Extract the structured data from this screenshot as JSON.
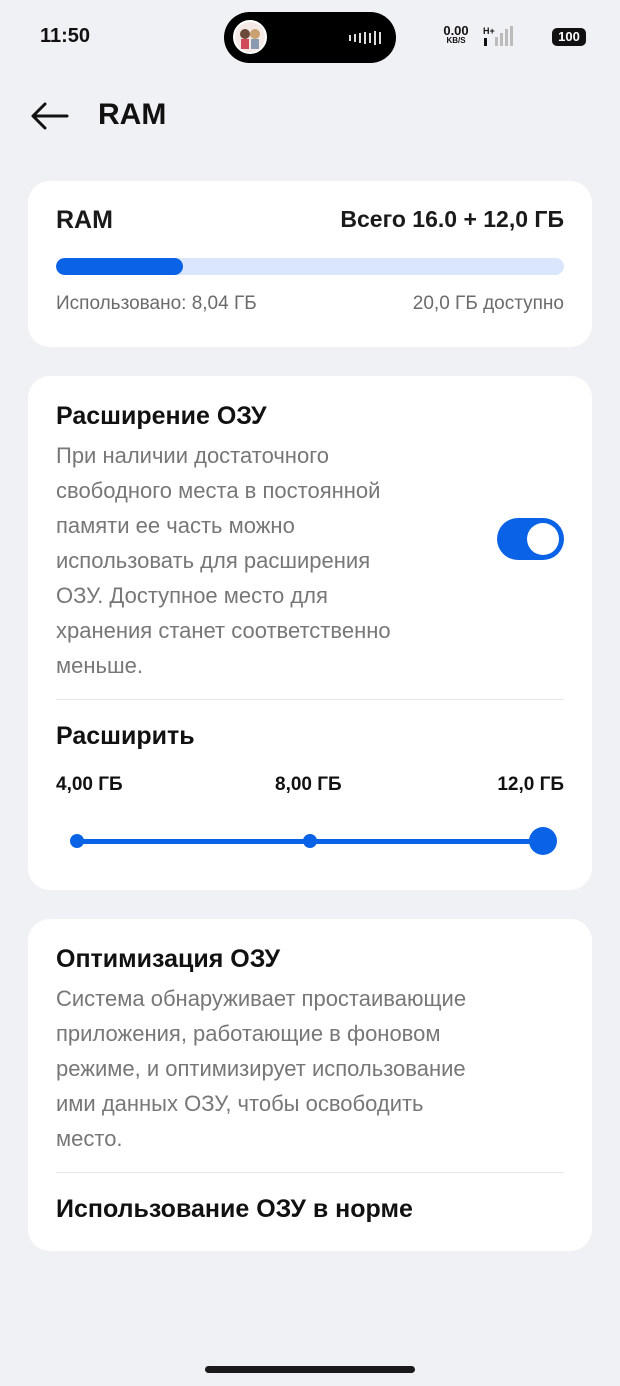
{
  "status_bar": {
    "time": "11:50",
    "net_speed": "0.00",
    "net_unit": "KB/S",
    "network_type": "H+",
    "battery": "100"
  },
  "header": {
    "title": "RAM",
    "back_icon": "arrow-left-icon"
  },
  "ram_card": {
    "label": "RAM",
    "total": "Всего 16.0 + 12,0 ГБ",
    "used": "Использовано: 8,04 ГБ",
    "available": "20,0 ГБ доступно",
    "used_fraction": 0.25
  },
  "expansion_card": {
    "title": "Расширение ОЗУ",
    "description_lines": [
      "При наличии достаточного",
      "свободного места в постоянной",
      "памяти ее часть можно",
      "использовать для расширения",
      "ОЗУ. Доступное место для",
      "хранения станет соответственно",
      "меньше."
    ],
    "toggle_on": true,
    "expand_title": "Расширить",
    "slider_options": [
      "4,00 ГБ",
      "8,00 ГБ",
      "12,0 ГБ"
    ],
    "slider_selected_index": 2
  },
  "optimization_card": {
    "title": "Оптимизация ОЗУ",
    "description_lines": [
      "Система обнаруживает простаивающие",
      "приложения, работающие в фоновом",
      "режиме, и оптимизирует использование",
      "ими данных ОЗУ, чтобы освободить",
      "место."
    ],
    "status": "Использование ОЗУ в норме"
  },
  "colors": {
    "accent": "#0a63e6",
    "track": "#d9e6fb",
    "background": "#f0f1f5"
  }
}
